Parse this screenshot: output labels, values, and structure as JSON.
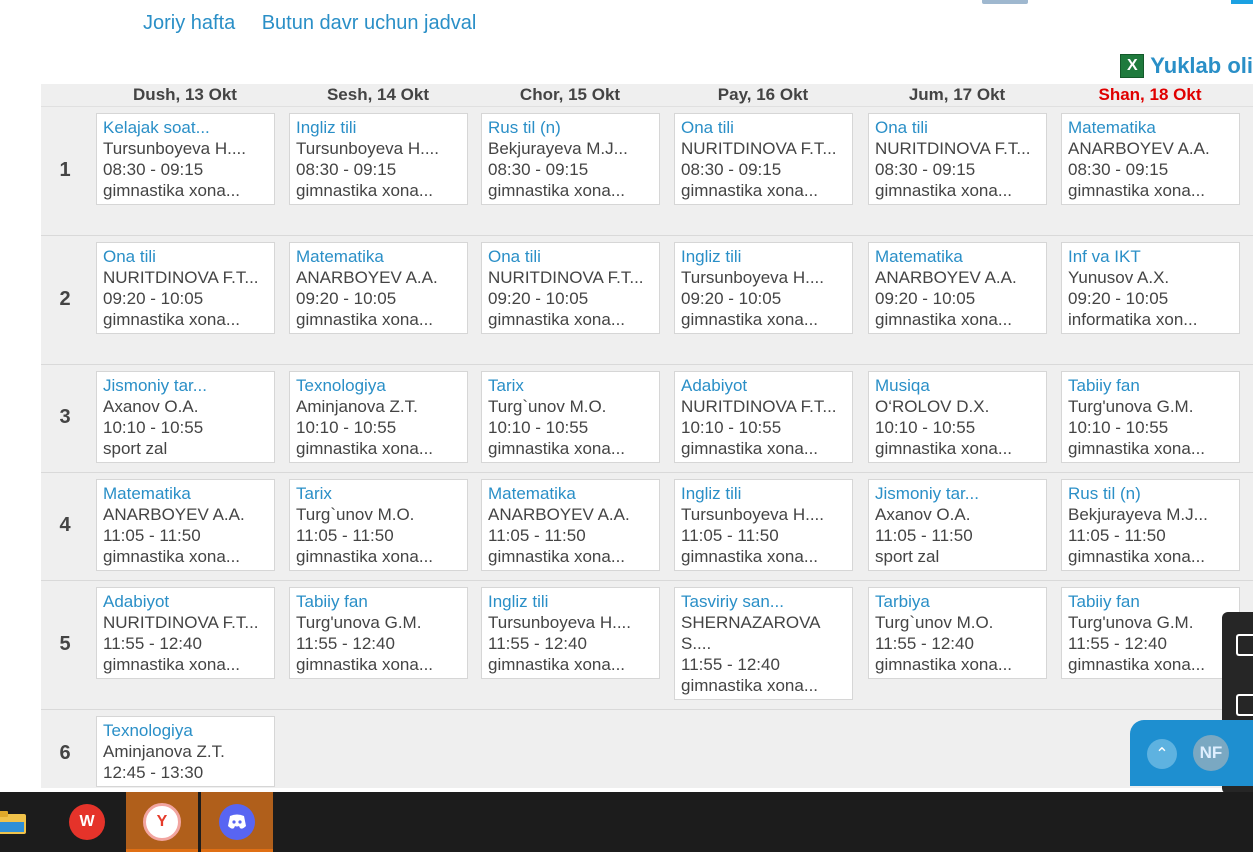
{
  "tabs": {
    "current_week": "Joriy hafta",
    "all_period": "Butun davr uchun jadval"
  },
  "download": {
    "icon": "excel-icon",
    "icon_glyph": "X",
    "label": "Yuklab oli"
  },
  "days": [
    "Dush, 13 Okt",
    "Sesh, 14 Okt",
    "Chor, 15 Okt",
    "Pay, 16 Okt",
    "Jum, 17 Okt",
    "Shan, 18 Okt"
  ],
  "rows": [
    {
      "num": "1",
      "cells": [
        {
          "subject": "Kelajak soat...",
          "teacher": "Tursunboyeva H....",
          "time": "08:30 - 09:15",
          "room": "gimnastika xona..."
        },
        {
          "subject": "Ingliz tili",
          "teacher": "Tursunboyeva H....",
          "time": "08:30 - 09:15",
          "room": "gimnastika xona..."
        },
        {
          "subject": "Rus til (n)",
          "teacher": "Bekjurayeva M.J...",
          "time": "08:30 - 09:15",
          "room": "gimnastika xona..."
        },
        {
          "subject": "Ona tili",
          "teacher": "NURITDINOVA F.T...",
          "time": "08:30 - 09:15",
          "room": "gimnastika xona..."
        },
        {
          "subject": "Ona tili",
          "teacher": "NURITDINOVA F.T...",
          "time": "08:30 - 09:15",
          "room": "gimnastika xona..."
        },
        {
          "subject": "Matematika",
          "teacher": "ANARBOYEV A.A.",
          "time": "08:30 - 09:15",
          "room": "gimnastika xona..."
        }
      ]
    },
    {
      "num": "2",
      "cells": [
        {
          "subject": "Ona tili",
          "teacher": "NURITDINOVA F.T...",
          "time": "09:20 - 10:05",
          "room": "gimnastika xona..."
        },
        {
          "subject": "Matematika",
          "teacher": "ANARBOYEV A.A.",
          "time": "09:20 - 10:05",
          "room": "gimnastika xona..."
        },
        {
          "subject": "Ona tili",
          "teacher": "NURITDINOVA F.T...",
          "time": "09:20 - 10:05",
          "room": "gimnastika xona..."
        },
        {
          "subject": "Ingliz tili",
          "teacher": "Tursunboyeva H....",
          "time": "09:20 - 10:05",
          "room": "gimnastika xona..."
        },
        {
          "subject": "Matematika",
          "teacher": "ANARBOYEV A.A.",
          "time": "09:20 - 10:05",
          "room": "gimnastika xona..."
        },
        {
          "subject": "Inf va IKT",
          "teacher": "Yunusov A.X.",
          "time": "09:20 - 10:05",
          "room": "informatika xon..."
        }
      ]
    },
    {
      "num": "3",
      "cells": [
        {
          "subject": "Jismoniy tar...",
          "teacher": "Axanov O.A.",
          "time": "10:10 - 10:55",
          "room": "sport zal"
        },
        {
          "subject": "Texnologiya",
          "teacher": "Aminjanova Z.T.",
          "time": "10:10 - 10:55",
          "room": "gimnastika xona..."
        },
        {
          "subject": "Tarix",
          "teacher": "Turg`unov M.O.",
          "time": "10:10 - 10:55",
          "room": "gimnastika xona..."
        },
        {
          "subject": "Adabiyot",
          "teacher": "NURITDINOVA F.T...",
          "time": "10:10 - 10:55",
          "room": "gimnastika xona..."
        },
        {
          "subject": "Musiqa",
          "teacher": "O‘ROLOV D.X.",
          "time": "10:10 - 10:55",
          "room": "gimnastika xona..."
        },
        {
          "subject": "Tabiiy fan",
          "teacher": "Turg'unova G.M.",
          "time": "10:10 - 10:55",
          "room": "gimnastika xona..."
        }
      ]
    },
    {
      "num": "4",
      "cells": [
        {
          "subject": "Matematika",
          "teacher": "ANARBOYEV A.A.",
          "time": "11:05 - 11:50",
          "room": "gimnastika xona..."
        },
        {
          "subject": "Tarix",
          "teacher": "Turg`unov M.O.",
          "time": "11:05 - 11:50",
          "room": "gimnastika xona..."
        },
        {
          "subject": "Matematika",
          "teacher": "ANARBOYEV A.A.",
          "time": "11:05 - 11:50",
          "room": "gimnastika xona..."
        },
        {
          "subject": "Ingliz tili",
          "teacher": "Tursunboyeva H....",
          "time": "11:05 - 11:50",
          "room": "gimnastika xona..."
        },
        {
          "subject": "Jismoniy tar...",
          "teacher": "Axanov O.A.",
          "time": "11:05 - 11:50",
          "room": "sport zal"
        },
        {
          "subject": "Rus til (n)",
          "teacher": "Bekjurayeva M.J...",
          "time": "11:05 - 11:50",
          "room": "gimnastika xona..."
        }
      ]
    },
    {
      "num": "5",
      "cells": [
        {
          "subject": "Adabiyot",
          "teacher": "NURITDINOVA F.T...",
          "time": "11:55 - 12:40",
          "room": "gimnastika xona..."
        },
        {
          "subject": "Tabiiy fan",
          "teacher": "Turg'unova G.M.",
          "time": "11:55 - 12:40",
          "room": "gimnastika xona..."
        },
        {
          "subject": "Ingliz tili",
          "teacher": "Tursunboyeva H....",
          "time": "11:55 - 12:40",
          "room": "gimnastika xona..."
        },
        {
          "subject": "Tasviriy san...",
          "teacher": "SHERNAZAROVA S....",
          "time": "11:55 - 12:40",
          "room": "gimnastika xona..."
        },
        {
          "subject": "Tarbiya",
          "teacher": "Turg`unov M.O.",
          "time": "11:55 - 12:40",
          "room": "gimnastika xona..."
        },
        {
          "subject": "Tabiiy fan",
          "teacher": "Turg'unova G.M.",
          "time": "11:55 - 12:40",
          "room": "gimnastika xona..."
        }
      ]
    },
    {
      "num": "6",
      "cells": [
        {
          "subject": "Texnologiya",
          "teacher": "Aminjanova Z.T.",
          "time": "12:45 - 13:30",
          "room": ""
        }
      ]
    }
  ],
  "chat": {
    "up_icon": "chevron-up-icon",
    "avatar_initials": "NF"
  },
  "taskbar": {
    "items": [
      {
        "name": "file-explorer-icon"
      },
      {
        "name": "wps-office-icon",
        "glyph": "W"
      },
      {
        "name": "yandex-browser-icon",
        "glyph": "Y"
      },
      {
        "name": "discord-icon"
      }
    ]
  },
  "colors": {
    "link": "#2a8fc7",
    "saturday": "#e00000",
    "taskbar": "#1c1c1c",
    "active_taskbar": "#b05f1b"
  }
}
